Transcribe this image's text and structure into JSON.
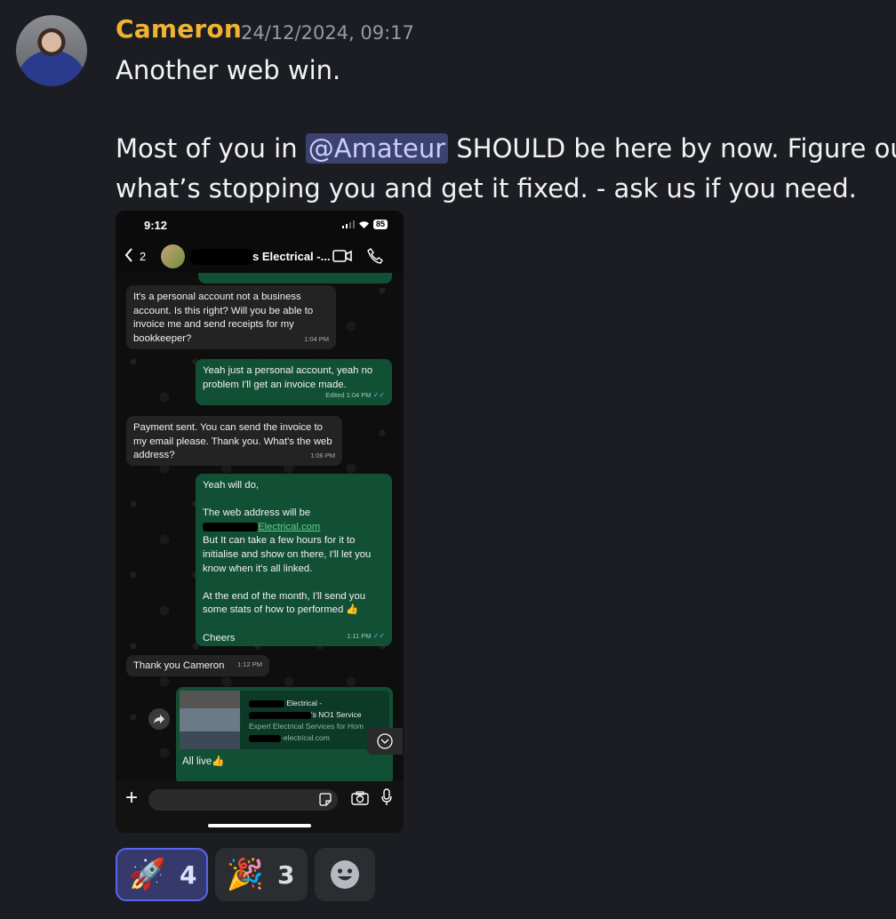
{
  "message": {
    "author": "Cameron",
    "timestamp": "24/12/2024, 09:17",
    "line1": "Another web win.",
    "line2_before": "Most of you in ",
    "mention": "@Amateur",
    "line2_after": " SHOULD be here by now. Figure out",
    "line3": "what’s stopping you and get it fixed. - ask us if you need."
  },
  "phone": {
    "time": "9:12",
    "battery": "85",
    "back_count": "2",
    "contact_name": "s Electrical -...",
    "messages": [
      {
        "dir": "in",
        "text": "It's a personal account not a business account. Is this right? Will you be able to invoice me and send receipts for my bookkeeper?",
        "time": "1:04 PM"
      },
      {
        "dir": "out",
        "text": "Yeah just a personal account, yeah no problem I'll get an invoice made.",
        "time": "Edited 1:04 PM"
      },
      {
        "dir": "in",
        "text": "Payment sent. You can send the invoice to my email please. Thank you. What's the web address?",
        "time": "1:06 PM"
      },
      {
        "dir": "out",
        "line1": "Yeah will do,",
        "line2": "The web address will be",
        "link": "Electrical.com",
        "line3": "But It can take a few hours for it to initialise and show on there, I'll let you know when it's all linked.",
        "line4": "At the end of the month, I'll send you some stats of how to performed 👍",
        "line5": "Cheers",
        "time": "1:11 PM"
      },
      {
        "dir": "in",
        "text": "Thank you Cameron",
        "time": "1:12 PM"
      }
    ],
    "preview": {
      "title1": "Electrical -",
      "title2": "'s NO1 Service",
      "desc": "Expert Electrical Services for Hom",
      "domain": "-electrical.com",
      "caption": "All live👍"
    }
  },
  "reactions": [
    {
      "emoji": "🚀",
      "count": "4",
      "active": true
    },
    {
      "emoji": "🎉",
      "count": "3",
      "active": false
    },
    {
      "emoji": "add-reaction-icon",
      "count": "",
      "active": false
    }
  ]
}
